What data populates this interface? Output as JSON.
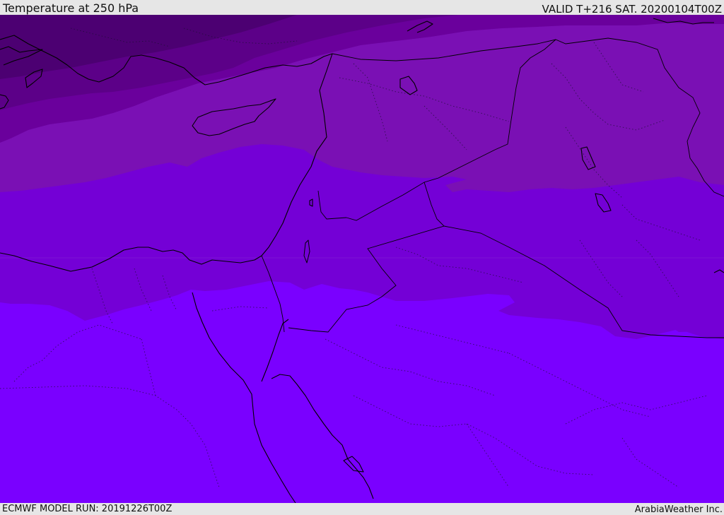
{
  "header": {
    "title": "Temperature at 250 hPa",
    "valid": "VALID T+216 SAT. 20200104T00Z"
  },
  "footer": {
    "model_run": "ECMWF MODEL RUN: 20191226T00Z",
    "credit": "ArabiaWeather Inc."
  },
  "colors": {
    "band_darkest": "#4c0072",
    "band_dark": "#5c0088",
    "band_mid": "#6a009c",
    "band_light": "#7a10b4",
    "band_lighter": "#7400d6",
    "band_violet": "#7d00f0",
    "band_brightest": "#7a00ff",
    "coastline": "#000000",
    "bar_background": "#e6e6e6"
  }
}
